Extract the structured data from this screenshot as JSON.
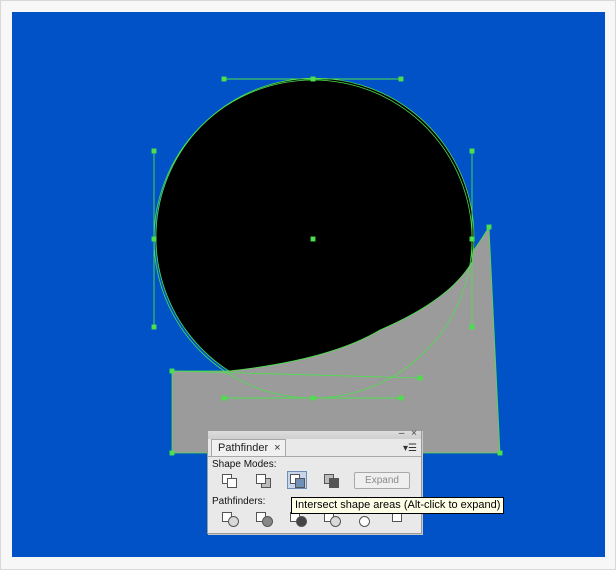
{
  "panel": {
    "tab_label": "Pathfinder",
    "tab_close": "×",
    "minimize": "‒",
    "close": "×",
    "menu": "▾☰",
    "shape_modes_label": "Shape Modes:",
    "pathfinders_label": "Pathfinders:",
    "expand_label": "Expand",
    "shape_mode_buttons": [
      "unite-icon",
      "minus-front-icon",
      "intersect-icon",
      "exclude-icon"
    ],
    "pathfinder_buttons": [
      "divide-icon",
      "trim-icon",
      "merge-icon",
      "crop-icon",
      "outline-icon",
      "minus-back-icon"
    ],
    "active_shape_mode": "intersect-icon"
  },
  "tooltip": {
    "text": "Intersect shape areas (Alt-click to expand)"
  },
  "colors": {
    "artboard": "#0052c6",
    "circle": "#000000",
    "shape": "#9b9b9b",
    "selection": "#4ddf4d"
  }
}
